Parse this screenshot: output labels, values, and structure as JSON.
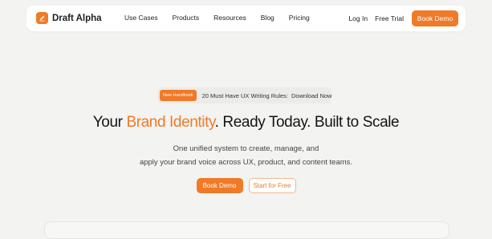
{
  "nav": {
    "brand": "Draft Alpha",
    "links": [
      "Use Cases",
      "Products",
      "Resources",
      "Blog",
      "Pricing"
    ],
    "login": "Log In",
    "trial": "Free Trial",
    "cta": "Book Demo"
  },
  "announcement": {
    "badge": "New Handbook",
    "text": "20 Must Have UX Writing Rules:",
    "link": "Download Now"
  },
  "hero": {
    "title_prefix": "Your ",
    "title_accent": "Brand Identity",
    "title_suffix": ". Ready Today. Built to Scale",
    "subtitle_line1": "One unified system to create, manage, and",
    "subtitle_line2": "apply your brand voice across UX, product, and content teams.",
    "primary_cta": "Book Demo",
    "secondary_cta": "Start for Free"
  },
  "colors": {
    "accent": "#f07a26",
    "background": "#f3f3f2"
  }
}
